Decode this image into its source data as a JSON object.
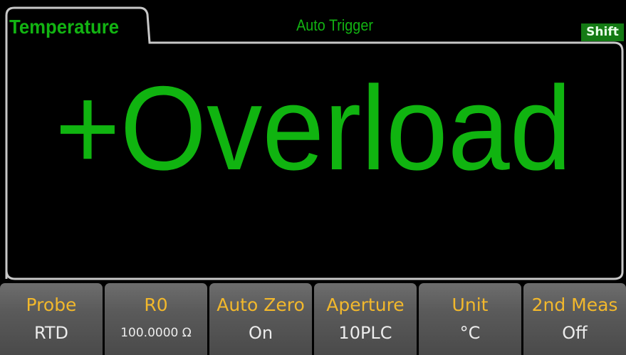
{
  "header": {
    "function_tab": "Temperature",
    "trigger_mode": "Auto Trigger",
    "shift_indicator": "Shift"
  },
  "display": {
    "reading": "+Overload"
  },
  "softkeys": [
    {
      "title": "Probe",
      "value": "RTD"
    },
    {
      "title": "R0",
      "value": "100.0000 Ω"
    },
    {
      "title": "Auto Zero",
      "value": "On"
    },
    {
      "title": "Aperture",
      "value": "10PLC"
    },
    {
      "title": "Unit",
      "value": "°C"
    },
    {
      "title": "2nd Meas",
      "value": "Off"
    }
  ],
  "colors": {
    "reading_green": "#10b410",
    "key_title_amber": "#f2b82c",
    "frame_gray": "#c8c8c8"
  }
}
